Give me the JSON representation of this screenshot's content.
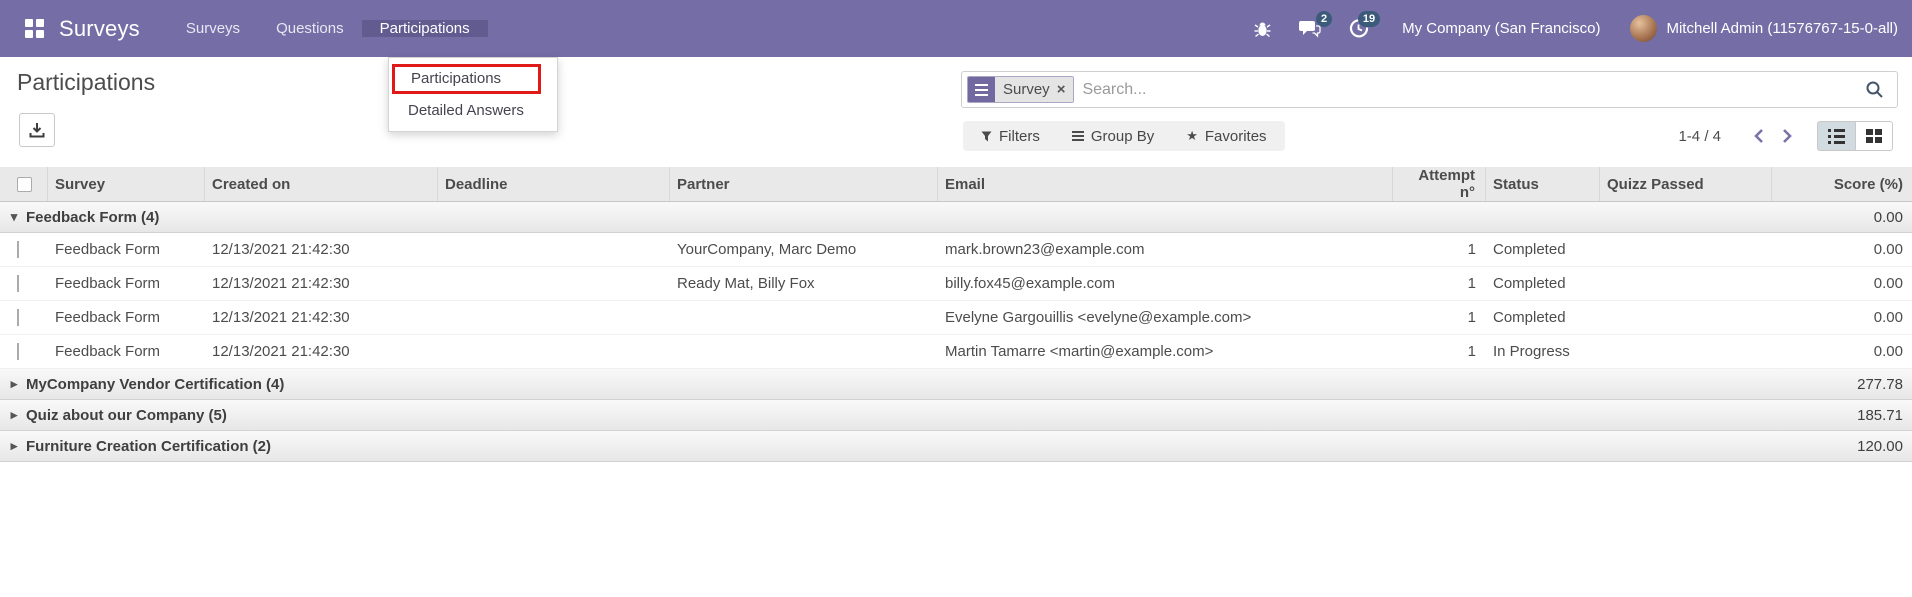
{
  "navbar": {
    "brand": "Surveys",
    "menu": {
      "surveys": "Surveys",
      "questions": "Questions",
      "participations": "Participations"
    },
    "messages_badge": "2",
    "activities_badge": "19",
    "company": "My Company (San Francisco)",
    "user": "Mitchell Admin (11576767-15-0-all)"
  },
  "dropdown": {
    "participations": "Participations",
    "detailed_answers": "Detailed Answers"
  },
  "page": {
    "title": "Participations"
  },
  "search": {
    "facet_label": "Survey",
    "placeholder": "Search..."
  },
  "controls": {
    "filters": "Filters",
    "group_by": "Group By",
    "favorites": "Favorites",
    "pager": "1-4 / 4"
  },
  "icons": {
    "caret_expanded": "▾",
    "caret_collapsed": "▸",
    "facet_remove": "×",
    "star": "★"
  },
  "table": {
    "columns": [
      "Survey",
      "Created on",
      "Deadline",
      "Partner",
      "Email",
      "Attempt n°",
      "Status",
      "Quizz Passed",
      "Score (%)"
    ],
    "groups": [
      {
        "label": "Feedback Form (4)",
        "score": "0.00",
        "rows": [
          {
            "survey": "Feedback Form",
            "created_on": "12/13/2021 21:42:30",
            "deadline": "",
            "partner": "YourCompany, Marc Demo",
            "email": "mark.brown23@example.com",
            "attempt": "1",
            "status": "Completed",
            "score": "0.00"
          },
          {
            "survey": "Feedback Form",
            "created_on": "12/13/2021 21:42:30",
            "deadline": "",
            "partner": "Ready Mat, Billy Fox",
            "email": "billy.fox45@example.com",
            "attempt": "1",
            "status": "Completed",
            "score": "0.00"
          },
          {
            "survey": "Feedback Form",
            "created_on": "12/13/2021 21:42:30",
            "deadline": "",
            "partner": "",
            "email": "Evelyne Gargouillis <evelyne@example.com>",
            "attempt": "1",
            "status": "Completed",
            "score": "0.00"
          },
          {
            "survey": "Feedback Form",
            "created_on": "12/13/2021 21:42:30",
            "deadline": "",
            "partner": "",
            "email": "Martin Tamarre <martin@example.com>",
            "attempt": "1",
            "status": "In Progress",
            "score": "0.00"
          }
        ]
      },
      {
        "label": "MyCompany Vendor Certification (4)",
        "score": "277.78"
      },
      {
        "label": "Quiz about our Company (5)",
        "score": "185.71"
      },
      {
        "label": "Furniture Creation Certification (2)",
        "score": "120.00"
      }
    ]
  },
  "colors": {
    "navbar": "#756EA6",
    "navbar_active": "#615B90",
    "accent_purple": "#7169A0",
    "badge": "#3C5B7A",
    "annotation_red": "#E01B17"
  }
}
